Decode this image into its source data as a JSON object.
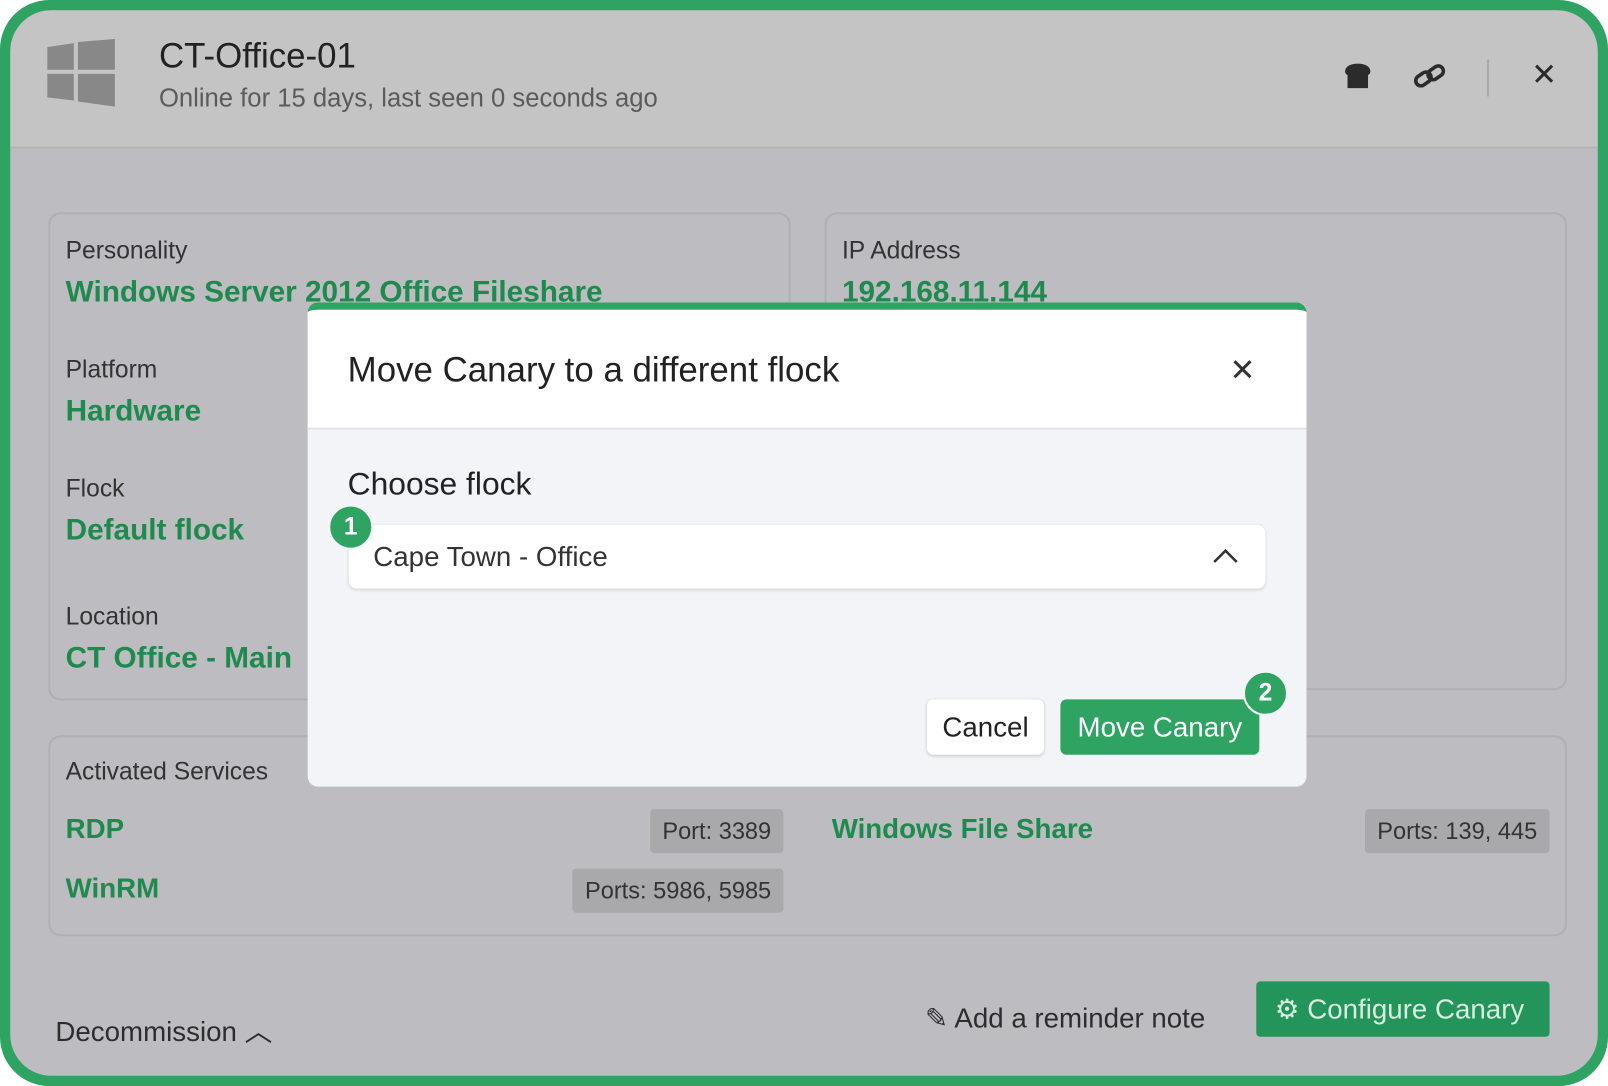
{
  "header": {
    "title": "CT-Office-01",
    "subtitle": "Online for 15 days, last seen 0 seconds ago",
    "icons": [
      "windows-logo",
      "bread-icon",
      "link-icon",
      "close-icon"
    ]
  },
  "details": {
    "personality": {
      "label": "Personality",
      "value": "Windows Server 2012 Office Fileshare"
    },
    "platform": {
      "label": "Platform",
      "value": "Hardware"
    },
    "flock": {
      "label": "Flock",
      "value": "Default flock"
    },
    "location": {
      "label": "Location",
      "value": "CT Office - Main"
    },
    "ip": {
      "label": "IP Address",
      "value": "192.168.11.144"
    }
  },
  "services": {
    "label": "Activated Services",
    "items": [
      {
        "name": "RDP",
        "ports": "Port: 3389"
      },
      {
        "name": "WinRM",
        "ports": "Ports: 5986, 5985"
      },
      {
        "name": "Windows File Share",
        "ports": "Ports: 139, 445"
      }
    ]
  },
  "footer": {
    "decommission": "Decommission",
    "reminder": "Add a reminder note",
    "configure": "Configure Canary"
  },
  "modal": {
    "title": "Move Canary to a different flock",
    "choose_label": "Choose flock",
    "selected": "Cape Town - Office",
    "cancel": "Cancel",
    "move": "Move Canary",
    "badge1": "1",
    "badge2": "2"
  },
  "colors": {
    "accent": "#2ea362",
    "value_green": "#1f8a4e"
  }
}
